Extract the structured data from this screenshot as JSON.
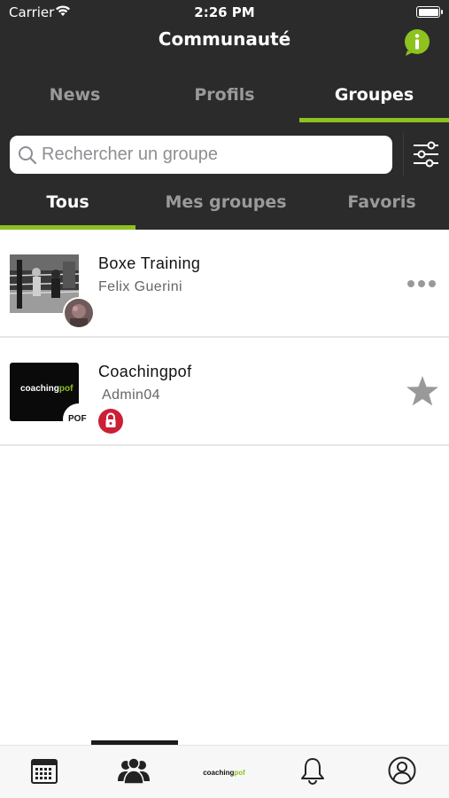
{
  "status_bar": {
    "carrier": "Carrier",
    "time": "2:26 PM"
  },
  "header": {
    "title": "Communauté",
    "info_icon": "info-icon"
  },
  "top_tabs": [
    {
      "label": "News",
      "active": false
    },
    {
      "label": "Profils",
      "active": false
    },
    {
      "label": "Groupes",
      "active": true
    }
  ],
  "search": {
    "placeholder": "Rechercher un groupe",
    "value": ""
  },
  "sub_tabs": [
    {
      "label": "Tous",
      "active": true
    },
    {
      "label": "Mes groupes",
      "active": false
    },
    {
      "label": "Favoris",
      "active": false
    }
  ],
  "groups": [
    {
      "name": "Boxe Training",
      "owner": "Felix Guerini",
      "private": false,
      "action_icon": "more-icon"
    },
    {
      "name": "Coachingpof",
      "owner": "Admin04",
      "private": true,
      "action_icon": "star-icon",
      "logo_text_a": "coaching",
      "logo_text_b": "pof",
      "avatar_text": "POF"
    }
  ],
  "tab_bar": {
    "active_index": 1,
    "items": [
      "calendar-icon",
      "community-icon",
      "coachingpof-logo",
      "bell-icon",
      "profile-icon"
    ],
    "logo_text_a": "coaching",
    "logo_text_b": "pof"
  },
  "colors": {
    "accent": "#8dc21f",
    "header_bg": "#2b2b2b",
    "lock": "#cc1f36"
  }
}
